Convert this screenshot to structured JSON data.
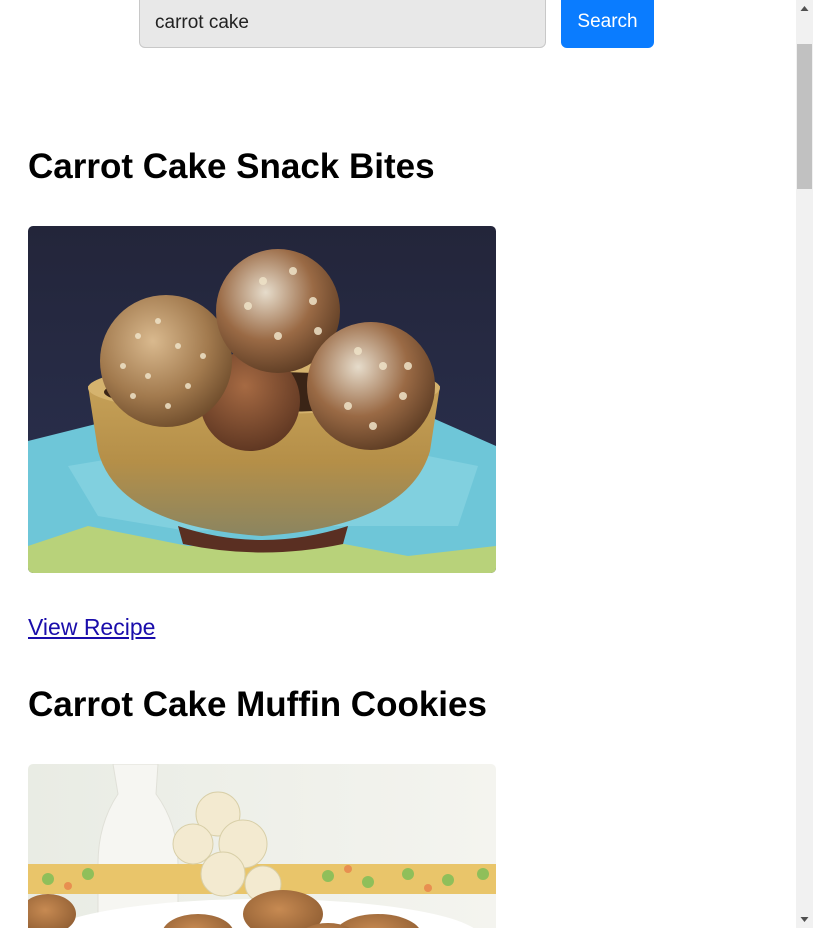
{
  "search": {
    "query": "carrot cake",
    "button_label": "Search"
  },
  "recipes": [
    {
      "title": "Carrot Cake Snack Bites",
      "image": "carrot-cake-snack-bites-photo",
      "link_label": "View Recipe"
    },
    {
      "title": "Carrot Cake Muffin Cookies",
      "image": "carrot-cake-muffin-cookies-photo"
    }
  ],
  "colors": {
    "button": "#0a7cff",
    "link": "#1a0dab",
    "input_bg": "#e8e8e8",
    "scrollbar_track": "#f1f1f1",
    "scrollbar_thumb": "#c1c1c1"
  },
  "icons": {
    "scroll_up": "scroll-up-arrow-icon",
    "scroll_down": "scroll-down-arrow-icon"
  }
}
